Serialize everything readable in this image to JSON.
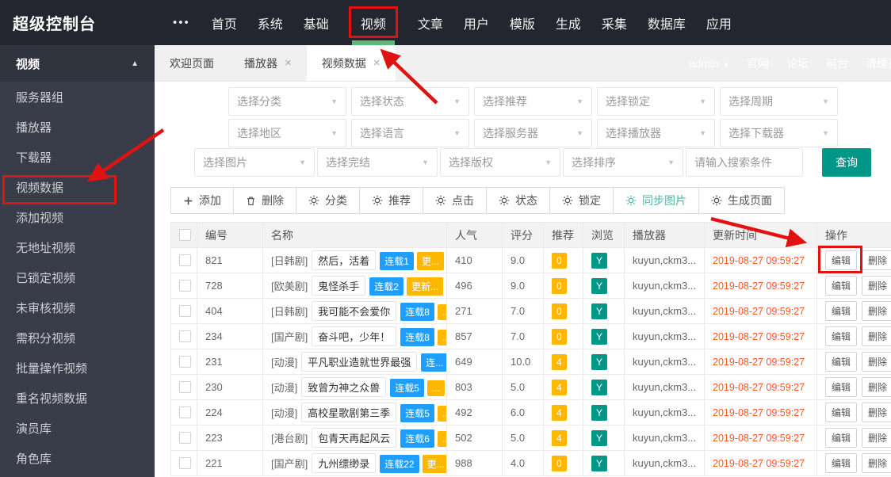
{
  "colors": {
    "topbar_bg": "#23262e",
    "sidebar_bg": "#393d49",
    "sidebar_header_bg": "#30343f",
    "tabbar_bg": "#f0f0f0",
    "accent_teal": "#009688",
    "sync_teal": "#44b8ab",
    "active_nav_green": "#5FB878",
    "badge_blue": "#1E9FFF",
    "badge_orange": "#FFB800",
    "time_red": "#FF5722",
    "annotation_red": "#e01212",
    "table_header_bg": "#f2f2f2"
  },
  "topbar": {
    "logo": "超级控制台",
    "more": "•••",
    "items": [
      {
        "label": "首页"
      },
      {
        "label": "系统"
      },
      {
        "label": "基础"
      },
      {
        "label": "视频",
        "active": true,
        "annotated": true
      },
      {
        "label": "文章"
      },
      {
        "label": "用户"
      },
      {
        "label": "模版"
      },
      {
        "label": "生成"
      },
      {
        "label": "采集"
      },
      {
        "label": "数据库"
      },
      {
        "label": "应用"
      }
    ]
  },
  "sidebar": {
    "header": {
      "label": "视频",
      "collapse_icon": "▲"
    },
    "items": [
      {
        "label": "服务器组"
      },
      {
        "label": "播放器"
      },
      {
        "label": "下载器"
      },
      {
        "label": "视频数据",
        "annotated": true
      },
      {
        "label": "添加视频"
      },
      {
        "label": "无地址视频"
      },
      {
        "label": "已锁定视频"
      },
      {
        "label": "未审核视频"
      },
      {
        "label": "需积分视频"
      },
      {
        "label": "批量操作视频"
      },
      {
        "label": "重名视频数据"
      },
      {
        "label": "演员库"
      },
      {
        "label": "角色库"
      }
    ]
  },
  "tabs": {
    "items": [
      {
        "label": "欢迎页面",
        "closable": false
      },
      {
        "label": "播放器",
        "closable": true
      },
      {
        "label": "视频数据",
        "closable": true,
        "active": true
      }
    ],
    "close_icon": "×",
    "user": {
      "name": "admin",
      "caret": "▼"
    },
    "links": [
      {
        "label": "官网"
      },
      {
        "label": "论坛"
      },
      {
        "label": "前台"
      },
      {
        "label": "清缓存"
      }
    ]
  },
  "filters": {
    "row1": [
      {
        "label": "选择分类"
      },
      {
        "label": "选择状态"
      },
      {
        "label": "选择推荐"
      },
      {
        "label": "选择锁定"
      },
      {
        "label": "选择周期"
      }
    ],
    "row2": [
      {
        "label": "选择地区"
      },
      {
        "label": "选择语言"
      },
      {
        "label": "选择服务器"
      },
      {
        "label": "选择播放器"
      },
      {
        "label": "选择下载器"
      }
    ],
    "row3": [
      {
        "label": "选择图片"
      },
      {
        "label": "选择完结"
      },
      {
        "label": "选择版权"
      },
      {
        "label": "选择排序"
      }
    ],
    "dropdown_caret": "▼",
    "search_placeholder": "请输入搜索条件",
    "search_button": "查询"
  },
  "toolbar": {
    "buttons": [
      {
        "icon": "plus",
        "label": "添加"
      },
      {
        "icon": "trash",
        "label": "删除"
      },
      {
        "icon": "gear",
        "label": "分类"
      },
      {
        "icon": "gear",
        "label": "推荐"
      },
      {
        "icon": "gear",
        "label": "点击"
      },
      {
        "icon": "gear",
        "label": "状态"
      },
      {
        "icon": "gear",
        "label": "锁定"
      },
      {
        "icon": "gear",
        "label": "同步图片",
        "accent": true
      },
      {
        "icon": "gear",
        "label": "生成页面"
      }
    ]
  },
  "table": {
    "headers": [
      "编号",
      "名称",
      "人气",
      "评分",
      "推荐",
      "浏览",
      "播放器",
      "更新时间",
      "操作"
    ],
    "edit_label": "编辑",
    "delete_label": "删除",
    "rows": [
      {
        "id": "821",
        "category": "[日韩剧]",
        "title": "然后，活着",
        "badge1": "连载1",
        "badge2": "更...",
        "pop": "410",
        "score": "9.0",
        "rec": "0",
        "view": "Y",
        "player": "kuyun,ckm3...",
        "time": "2019-08-27 09:59:27"
      },
      {
        "id": "728",
        "category": "[欧美剧]",
        "title": "鬼怪杀手",
        "badge1": "连载2",
        "badge2": "更新...",
        "pop": "496",
        "score": "9.0",
        "rec": "0",
        "view": "Y",
        "player": "kuyun,ckm3...",
        "time": "2019-08-27 09:59:27"
      },
      {
        "id": "404",
        "category": "[日韩剧]",
        "title": "我可能不会爱你",
        "badge1": "连载8",
        "badge2": "...",
        "pop": "271",
        "score": "7.0",
        "rec": "0",
        "view": "Y",
        "player": "kuyun,ckm3...",
        "time": "2019-08-27 09:59:27"
      },
      {
        "id": "234",
        "category": "[国产剧]",
        "title": "奋斗吧，少年！",
        "badge1": "连载8",
        "badge2": "...",
        "pop": "857",
        "score": "7.0",
        "rec": "0",
        "view": "Y",
        "player": "kuyun,ckm3...",
        "time": "2019-08-27 09:59:27"
      },
      {
        "id": "231",
        "category": "[动漫]",
        "title": "平凡职业造就世界最强",
        "badge1": "连...",
        "badge2": "",
        "pop": "649",
        "score": "10.0",
        "rec": "4",
        "view": "Y",
        "player": "kuyun,ckm3...",
        "time": "2019-08-27 09:59:27"
      },
      {
        "id": "230",
        "category": "[动漫]",
        "title": "致曾为神之众兽",
        "badge1": "连载5",
        "badge2": "...",
        "pop": "803",
        "score": "5.0",
        "rec": "4",
        "view": "Y",
        "player": "kuyun,ckm3...",
        "time": "2019-08-27 09:59:27"
      },
      {
        "id": "224",
        "category": "[动漫]",
        "title": "高校星歌剧第三季",
        "badge1": "连载5",
        "badge2": "...",
        "pop": "492",
        "score": "6.0",
        "rec": "4",
        "view": "Y",
        "player": "kuyun,ckm3...",
        "time": "2019-08-27 09:59:27"
      },
      {
        "id": "223",
        "category": "[港台剧]",
        "title": "包青天再起风云",
        "badge1": "连载6",
        "badge2": "...",
        "pop": "502",
        "score": "5.0",
        "rec": "4",
        "view": "Y",
        "player": "kuyun,ckm3...",
        "time": "2019-08-27 09:59:27"
      },
      {
        "id": "221",
        "category": "[国产剧]",
        "title": "九州缥缈录",
        "badge1": "连载22",
        "badge2": "更...",
        "pop": "988",
        "score": "4.0",
        "rec": "0",
        "view": "Y",
        "player": "kuyun,ckm3...",
        "time": "2019-08-27 09:59:27"
      }
    ]
  }
}
